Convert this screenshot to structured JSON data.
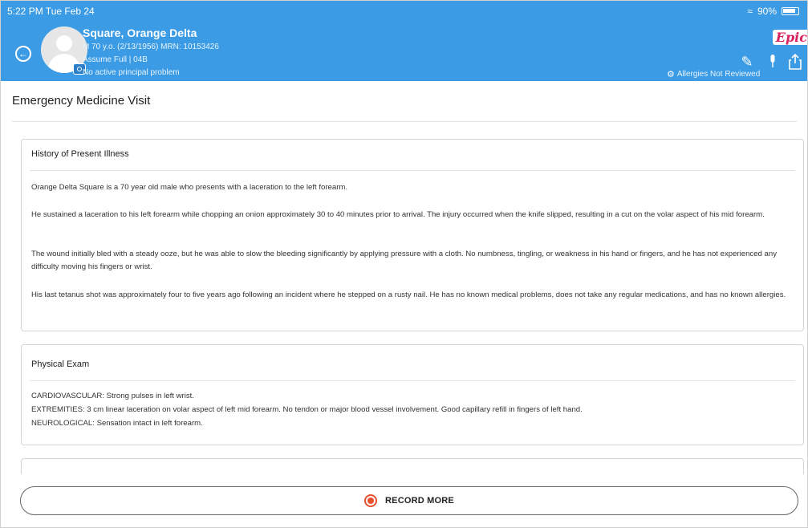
{
  "status_bar": {
    "time": "5:22 PM  Tue Feb 24",
    "battery": "90%"
  },
  "patient": {
    "name": "Square, Orange Delta",
    "demographics": "M 70 y.o. (2/13/1956) MRN: 10153426",
    "status": "Assume Full | 04B",
    "problem": "No active principal problem",
    "allergies": "Allergies Not Reviewed"
  },
  "app": {
    "logo": "Epic"
  },
  "page": {
    "title": "Emergency Medicine Visit"
  },
  "hpi": {
    "title": "History of Present Illness",
    "paragraphs": [
      "Orange Delta Square is a 70 year old male who presents with a laceration to the left forearm.",
      "He sustained a laceration to his left forearm while chopping an onion approximately 30 to 40 minutes prior to arrival. The injury occurred when the knife slipped, resulting in a cut on the volar aspect of his mid forearm.",
      "The wound initially bled with a steady ooze, but he was able to slow the bleeding significantly by applying pressure with a cloth. No numbness, tingling, or weakness in his hand or fingers, and he has not experienced any difficulty moving his fingers or wrist.",
      "His last tetanus shot was approximately four to five years ago following an incident where he stepped on a rusty nail. He has no known medical problems, does not take any regular medications, and has no known allergies."
    ]
  },
  "physical_exam": {
    "title": "Physical Exam",
    "lines": [
      "CARDIOVASCULAR: Strong pulses in left wrist.",
      "EXTREMITIES: 3 cm linear laceration on volar aspect of left mid forearm. No tendon or major blood vessel involvement. Good capillary refill in fingers of left hand.",
      "NEUROLOGICAL: Sensation intact in left forearm."
    ]
  },
  "actions": {
    "record_more": "RECORD MORE"
  },
  "colors": {
    "header": "#3b9be4",
    "record": "#e8512c",
    "logo": "#d8215b"
  }
}
